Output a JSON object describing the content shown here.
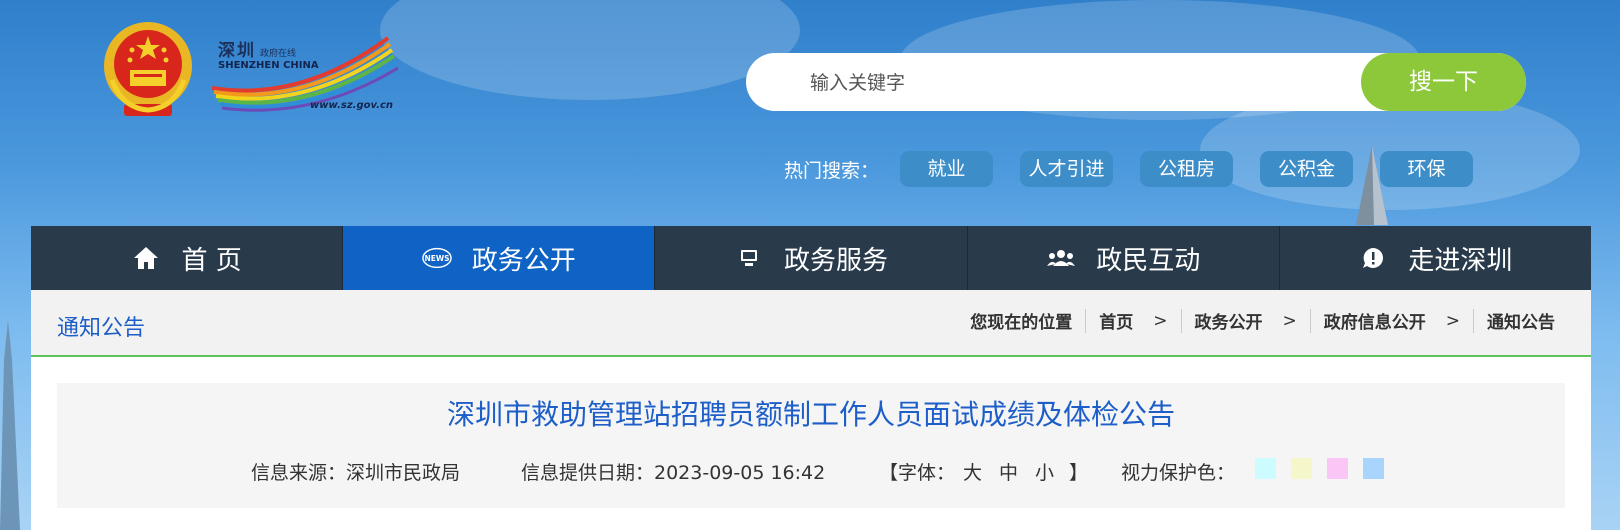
{
  "header": {
    "logo_cn": "深圳",
    "logo_cn_small": "政府在线",
    "logo_en": "SHENZHEN  CHINA",
    "logo_url": "www.sz.gov.cn"
  },
  "search": {
    "placeholder": "输入关键字",
    "button_label": "搜一下"
  },
  "hot_search": {
    "label": "热门搜索：",
    "tags": [
      "就业",
      "人才引进",
      "公租房",
      "公积金",
      "环保"
    ]
  },
  "nav": {
    "items": [
      {
        "label": "首 页",
        "icon": "home-icon",
        "active": false
      },
      {
        "label": "政务公开",
        "icon": "news-icon",
        "active": true
      },
      {
        "label": "政务服务",
        "icon": "monitor-icon",
        "active": false
      },
      {
        "label": "政民互动",
        "icon": "users-icon",
        "active": false
      },
      {
        "label": "走进深圳",
        "icon": "chat-bubble-icon",
        "active": false
      }
    ]
  },
  "breadcrumb": {
    "section_title": "通知公告",
    "location_label": "您现在的位置",
    "items": [
      "首页",
      "政务公开",
      "政府信息公开",
      "通知公告"
    ],
    "separator": ">"
  },
  "article": {
    "title": "深圳市救助管理站招聘员额制工作人员面试成绩及体检公告",
    "source": "信息来源：深圳市民政局",
    "date": "信息提供日期：2023-09-05 16:42",
    "font_open": "【字体：",
    "font_large": "大",
    "font_medium": "中",
    "font_small": "小",
    "font_close": "】",
    "eye_care_label": "视力保护色：",
    "eye_care_colors": [
      "#ccfcff",
      "#f5f6c9",
      "#f9c6f5",
      "#a9d4fb"
    ]
  },
  "colors": {
    "nav_bg": "#293a4b",
    "nav_active": "#0f63c4",
    "search_button": "#8cc83a",
    "link_blue": "#1d5ec8",
    "divider_green": "#5ec45a"
  }
}
